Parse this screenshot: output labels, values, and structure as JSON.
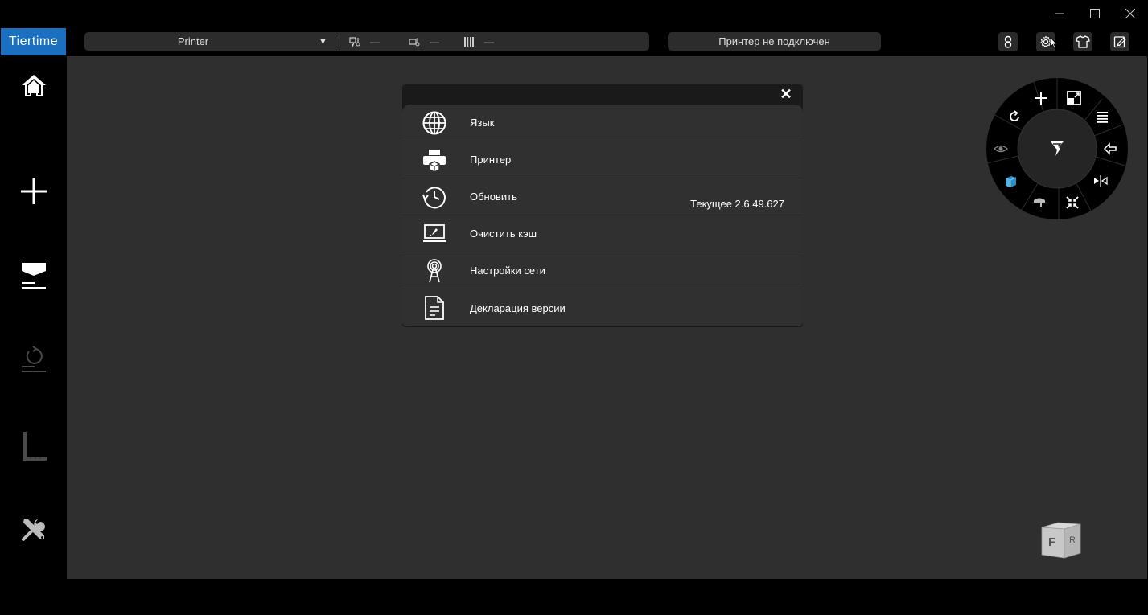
{
  "window": {
    "brand": "Tiertime"
  },
  "topbar": {
    "printer_name": "Printer",
    "printer_dropdown_arrow": "▼",
    "nozzle_temp": "—",
    "bed_temp": "—",
    "filament": "—",
    "status": "Принтер не подключен",
    "icons": [
      "account-icon",
      "settings-icon",
      "shirt-icon",
      "edit-export-icon"
    ]
  },
  "sidebar": {
    "items": [
      "home-icon",
      "add-icon",
      "print-icon",
      "undo-icon",
      "ruler-icon",
      "tools-icon"
    ]
  },
  "settings_dialog": {
    "close": "✕",
    "items": [
      {
        "icon": "globe-icon",
        "label": "Язык"
      },
      {
        "icon": "printer-icon",
        "label": "Принтер"
      },
      {
        "icon": "history-icon",
        "label": "Обновить",
        "extra": "Текущее 2.6.49.627"
      },
      {
        "icon": "laptop-clean-icon",
        "label": "Очистить кэш"
      },
      {
        "icon": "antenna-icon",
        "label": "Настройки сети"
      },
      {
        "icon": "document-icon",
        "label": "Декларация версии"
      }
    ]
  },
  "tool_wheel": {
    "items": [
      "move-icon",
      "scale-icon",
      "layers-icon",
      "undo-arrow-icon",
      "mirror-icon",
      "shrink-icon",
      "place-icon",
      "cube-icon",
      "view-icon",
      "rotate-icon",
      "center-logo-icon"
    ]
  },
  "view_cube": {
    "front": "F",
    "right": "R"
  }
}
